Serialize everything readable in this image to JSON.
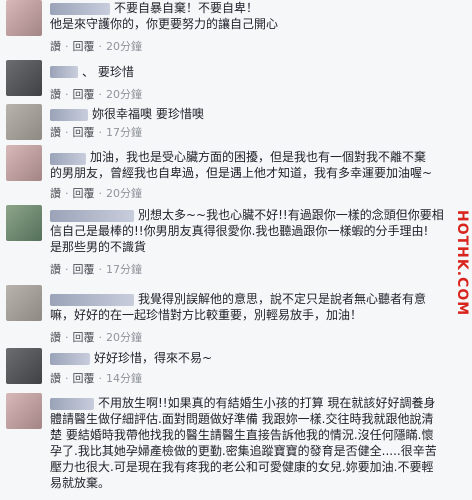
{
  "watermark": "HOTHK.COM",
  "meta_labels": {
    "like": "讚",
    "reply": "回覆",
    "sep": "·"
  },
  "comments": [
    {
      "lines": [
        "不要自暴自棄！不要自卑！",
        "他是來守護你的，你更要努力的讓自己開心"
      ],
      "time": "20分鐘"
    },
    {
      "lines": [
        "、 要珍惜"
      ],
      "time": "20分鐘"
    },
    {
      "lines": [
        "妳很幸福噢 要珍惜噢"
      ],
      "time": "17分鐘"
    },
    {
      "lines": [
        "加油，我也是受心臟方面的困擾，但是我也有一個對我不離不棄",
        "的男朋友，曾經我也自卑過，但是遇上他才知道，我有多幸運要加油喔~"
      ],
      "time": "20分鐘"
    },
    {
      "lines": [
        "別想太多~~我也心臟不好!!有過跟你一樣的念頭但你要相",
        "信自己是最棒的!!你男朋友真得很愛你.我也聽過跟你一樣蝦的分手理由!",
        "是那些男的不識貨"
      ],
      "time": "17分鐘"
    },
    {
      "lines": [
        "我覺得別誤解他的意思，說不定只是說者無心聽者有意",
        "嘛，好好的在一起珍惜對方比較重要，別輕易放手，加油！"
      ],
      "time": "20分鐘"
    },
    {
      "lines": [
        "好好珍惜，得來不易~"
      ],
      "time": "14分鐘"
    },
    {
      "lines": [
        "不用放生啊!!如果真的有結婚生小孩的打算 現在就該好好調養身",
        "體請醫生做仔細評估.面對問題做好準備 我跟妳一樣.交往時我就跟他說清",
        "楚 要結婚時我帶他找我的醫生請醫生直接告訴他我的情況.沒任何隱瞞.懷",
        "孕了.我比其她孕婦產檢做的更勤.密集追蹤寶寶的發育是否健全.....很辛苦",
        "壓力也很大.可是現在我有疼我的老公和可愛健康的女兒.妳要加油.不要輕",
        "易就放棄。"
      ]
    }
  ]
}
